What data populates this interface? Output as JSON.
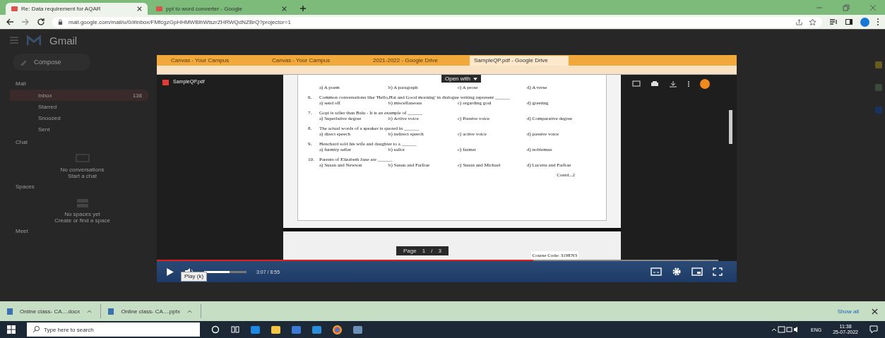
{
  "browser": {
    "tabs": [
      {
        "title": "Re: Data requirement for AQAR",
        "selected": true
      },
      {
        "title": "ppt to word converter - Google",
        "selected": false
      }
    ],
    "url": "mail.google.com/mail/u/0/#inbox/FMfcgzGpHHMWBlhWlszrZHRWQdNZBrQ?projector=1"
  },
  "gmail": {
    "app_name": "Gmail",
    "compose": "Compose",
    "mail_header": "Mail",
    "nav": [
      {
        "label": "Inbox",
        "count": "138",
        "selected": true
      },
      {
        "label": "Starred",
        "selected": false
      },
      {
        "label": "Snoozed",
        "selected": false
      },
      {
        "label": "Sent",
        "selected": false
      }
    ],
    "chat_header": "Chat",
    "chat_empty": "No conversations",
    "chat_link": "Start a chat",
    "spaces_header": "Spaces",
    "spaces_empty": "No spaces yet",
    "spaces_link": "Create or find a space",
    "meet_header": "Meet"
  },
  "video": {
    "inner_tabs": [
      {
        "title": "Canvas - Your Campus",
        "selected": false
      },
      {
        "title": "Canvas - Your Campus",
        "selected": false
      },
      {
        "title": "2021-2022 - Google Drive",
        "selected": false
      },
      {
        "title": "SampleQP.pdf - Google Drive",
        "selected": true
      }
    ],
    "file_name": "SampleQP.pdf",
    "open_with": "Open with",
    "questions": [
      {
        "options": [
          "a) A poem",
          "b) A paragraph",
          "c) A prose",
          "d) A verse"
        ]
      },
      {
        "number": "6.",
        "text": "Common conversations like 'Hello,Hai and Good morning' in dialogue writing represent ______",
        "options": [
          "a) send off",
          "b) miscellaneous",
          "c) regarding goal",
          "d) greeting"
        ]
      },
      {
        "number": "7.",
        "text": "Gopi is taller than Balu - It is an example of ______",
        "options": [
          "a) Superlative degree",
          "b) Active voice",
          "c) Passive voice",
          "d) Comparative degree"
        ]
      },
      {
        "number": "8.",
        "text": "The actual words of a speaker is quoted in ______",
        "options": [
          "a) direct speech",
          "b) indirect speech",
          "c) active voice",
          "d) passive voice"
        ]
      },
      {
        "number": "9.",
        "text": "Henchard sold his wife and daughter to a ______",
        "options": [
          "a) furmity seller",
          "b) sailor",
          "c) farmer",
          "d) nobleman"
        ]
      },
      {
        "number": "10.",
        "text": "Parents of Elizabeth Jane are ______",
        "options": [
          "a) Susan and Newson",
          "b) Susan and Farfrae",
          "c) Susan and Michael",
          "d) Lucetta and Farfrae"
        ]
      }
    ],
    "contd": "Contd...2",
    "course_code": "Course Code: 319EN3",
    "page_label": "Page",
    "page_num": "1",
    "page_sep": "/",
    "page_total": "3",
    "progress": {
      "level": 0.67
    },
    "volume": {
      "level": 0.6
    },
    "time": "3:07 / 8:55",
    "tooltip": "Play (k)"
  },
  "downloads": {
    "items": [
      "Online class- CA....docx",
      "Online class- CA....pptx"
    ],
    "show_all": "Show all"
  },
  "taskbar": {
    "search_placeholder": "Type here to search",
    "language": "ENG",
    "time": "11:38",
    "date": "25-07-2022"
  }
}
